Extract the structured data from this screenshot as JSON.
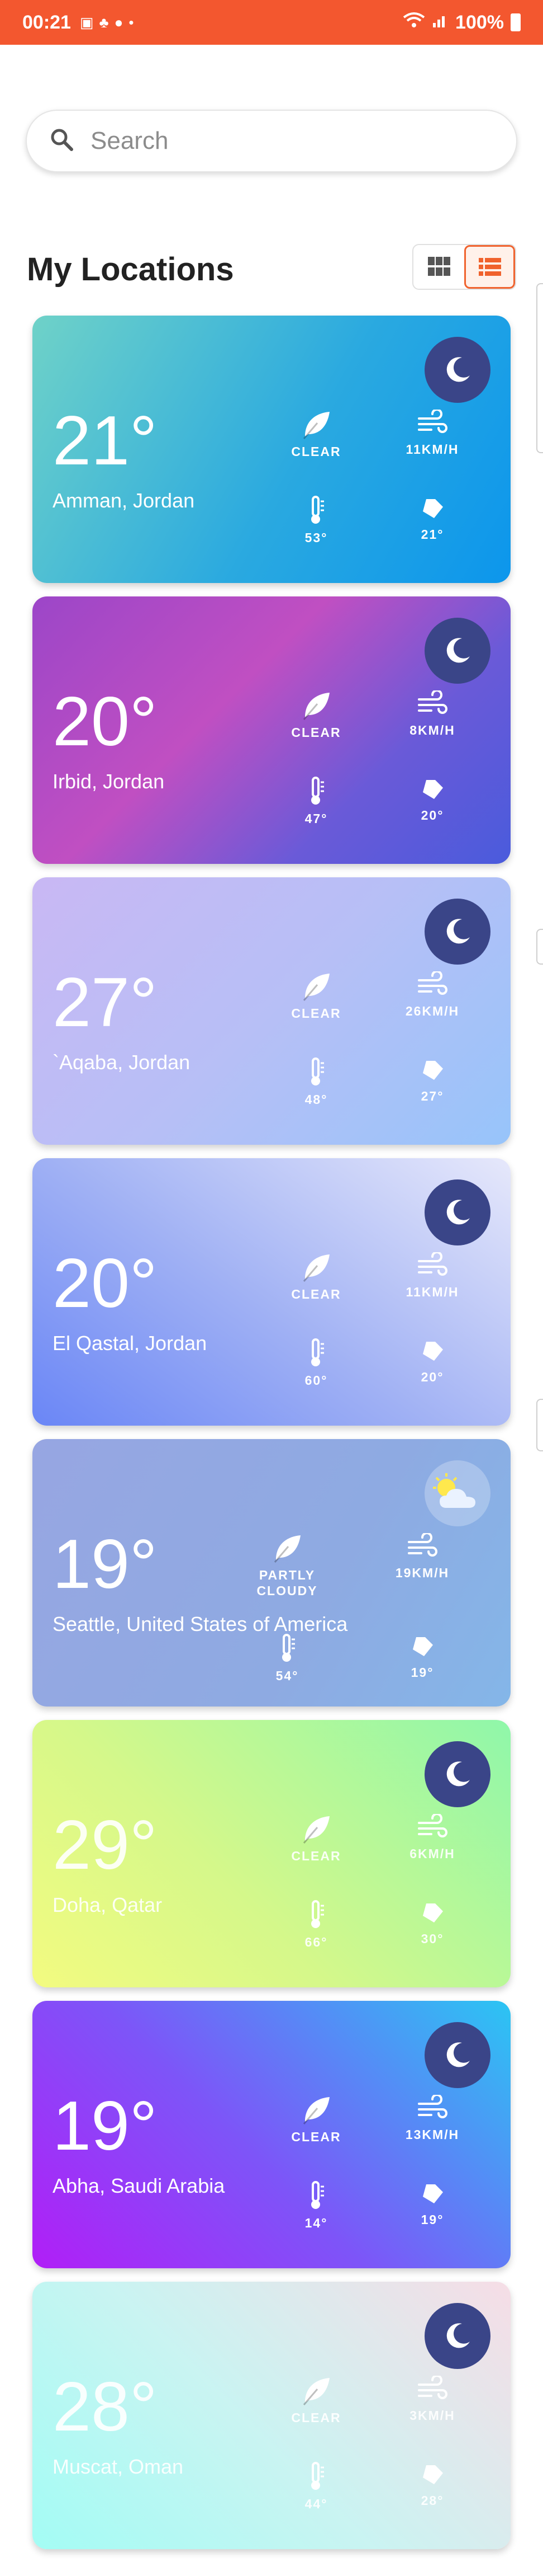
{
  "status_bar": {
    "time": "00:21",
    "battery": "100%"
  },
  "search": {
    "placeholder": "Search"
  },
  "section_title": "My Locations",
  "view_toggle": {
    "active": "list"
  },
  "colors": {
    "status_bar": "#f3572f",
    "accent": "#f0622d",
    "night_icon": "#3a4588"
  },
  "locations": [
    {
      "temp": "21°",
      "city": "Amman, Jordan",
      "condition": "CLEAR",
      "wind": "11KM/H",
      "feels": "53°",
      "humidity": "21°",
      "icon": "moon-icon",
      "gradient": "linear-gradient(120deg,#6fd2c8 0%,#2aa9e0 55%,#0c96ec 100%)"
    },
    {
      "temp": "20°",
      "city": "Irbid, Jordan",
      "condition": "CLEAR",
      "wind": "8KM/H",
      "feels": "47°",
      "humidity": "20°",
      "icon": "moon-icon",
      "gradient": "linear-gradient(135deg,#9c46c8 0%,#c04fc2 40%,#6a5ad8 70%,#4a5bdc 100%)"
    },
    {
      "temp": "27°",
      "city": "`Aqaba, Jordan",
      "condition": "CLEAR",
      "wind": "26KM/H",
      "feels": "48°",
      "humidity": "27°",
      "icon": "moon-icon",
      "gradient": "linear-gradient(135deg,#c9b8f4 0%,#b7bff6 50%,#97c4fa 100%)"
    },
    {
      "temp": "20°",
      "city": "El Qastal, Jordan",
      "condition": "CLEAR",
      "wind": "11KM/H",
      "feels": "60°",
      "humidity": "20°",
      "icon": "moon-icon",
      "gradient": "linear-gradient(35deg,#6a86f6 0%,#9fb0f4 45%,#e6e8fb 100%)"
    },
    {
      "temp": "19°",
      "city": "Seattle, United States of America",
      "condition": "PARTLY CLOUDY",
      "wind": "19KM/H",
      "feels": "54°",
      "humidity": "19°",
      "icon": "partly-cloudy-icon",
      "gradient": "linear-gradient(120deg,#97a6e2 0%,#8eaae2 60%,#84b6e8 100%)"
    },
    {
      "temp": "29°",
      "city": "Doha, Qatar",
      "condition": "CLEAR",
      "wind": "6KM/H",
      "feels": "66°",
      "humidity": "30°",
      "icon": "moon-icon",
      "gradient": "linear-gradient(45deg,#f3fb80 0%,#d5f88a 40%,#8ff7aa 100%)"
    },
    {
      "temp": "19°",
      "city": "Abha, Saudi Arabia",
      "condition": "CLEAR",
      "wind": "13KM/H",
      "feels": "14°",
      "humidity": "19°",
      "icon": "moon-icon",
      "gradient": "linear-gradient(45deg,#b11ef7 0%,#7d55f8 45%,#2bc5f3 100%)"
    },
    {
      "temp": "28°",
      "city": "Muscat, Oman",
      "condition": "CLEAR",
      "wind": "3KM/H",
      "feels": "44°",
      "humidity": "28°",
      "icon": "moon-icon",
      "gradient": "linear-gradient(45deg,#a3fcf4 0%,#c9f4f2 45%,#f6dde6 100%)"
    }
  ]
}
